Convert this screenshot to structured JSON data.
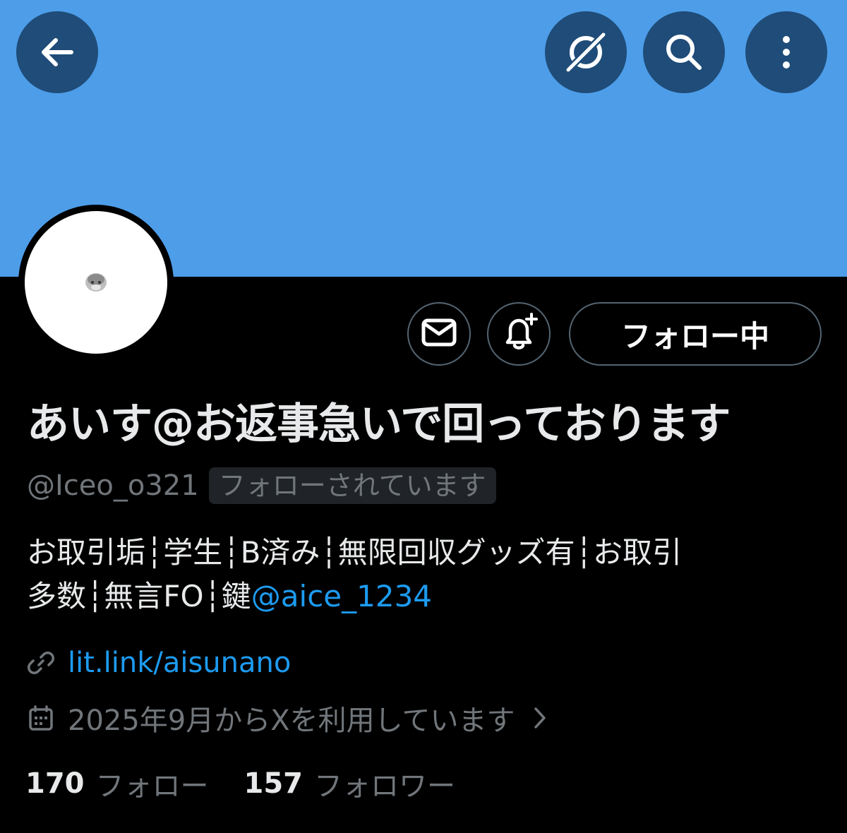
{
  "header": {
    "back_icon": "arrow-left-icon",
    "grok_icon": "grok-icon",
    "search_icon": "search-icon",
    "more_icon": "more-vertical-icon",
    "banner_color": "#4d9de9"
  },
  "profile": {
    "display_name": "あいす@お返事急いで回っております",
    "handle": "@Iceo_o321",
    "follows_you": "フォローされています",
    "bio_line1": "お取引垢┆学生┆B済み┆無限回収グッズ有┆お取引",
    "bio_line2_prefix": "多数┆無言FO┆鍵",
    "bio_mention": "@aice_1234",
    "link": "lit.link/aisunano",
    "joined": "2025年9月からXを利用しています"
  },
  "actions": {
    "message_icon": "mail-icon",
    "notify_icon": "bell-plus-icon",
    "following_label": "フォロー中"
  },
  "stats": {
    "following_count": "170",
    "following_label": "フォロー",
    "followers_count": "157",
    "followers_label": "フォロワー"
  },
  "colors": {
    "accent": "#1d9bf0",
    "muted": "#71767b",
    "background": "#000000"
  }
}
